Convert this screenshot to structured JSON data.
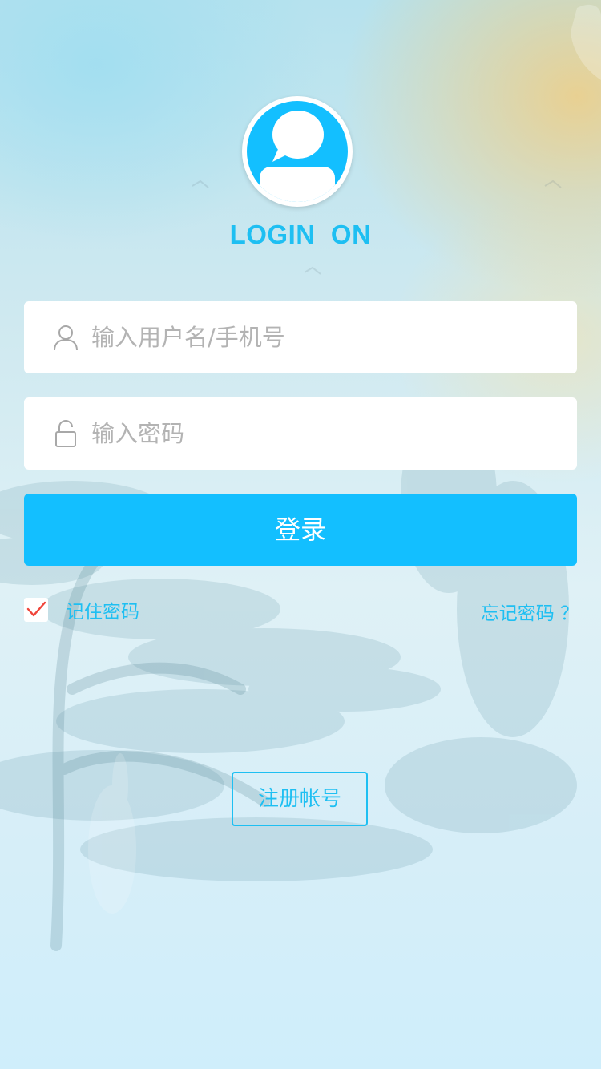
{
  "header": {
    "title": "LOGIN  ON"
  },
  "form": {
    "username": {
      "placeholder": "输入用户名/手机号",
      "value": "",
      "icon": "user-icon"
    },
    "password": {
      "placeholder": "输入密码",
      "value": "",
      "icon": "lock-icon"
    },
    "login_label": "登录",
    "remember_label": "记住密码",
    "remember_checked": true,
    "forgot_label": "忘记密码 ？"
  },
  "footer": {
    "register_label": "注册帐号"
  },
  "colors": {
    "accent": "#13bfff",
    "text_accent": "#1ebff2",
    "check_mark": "#f0443a"
  }
}
